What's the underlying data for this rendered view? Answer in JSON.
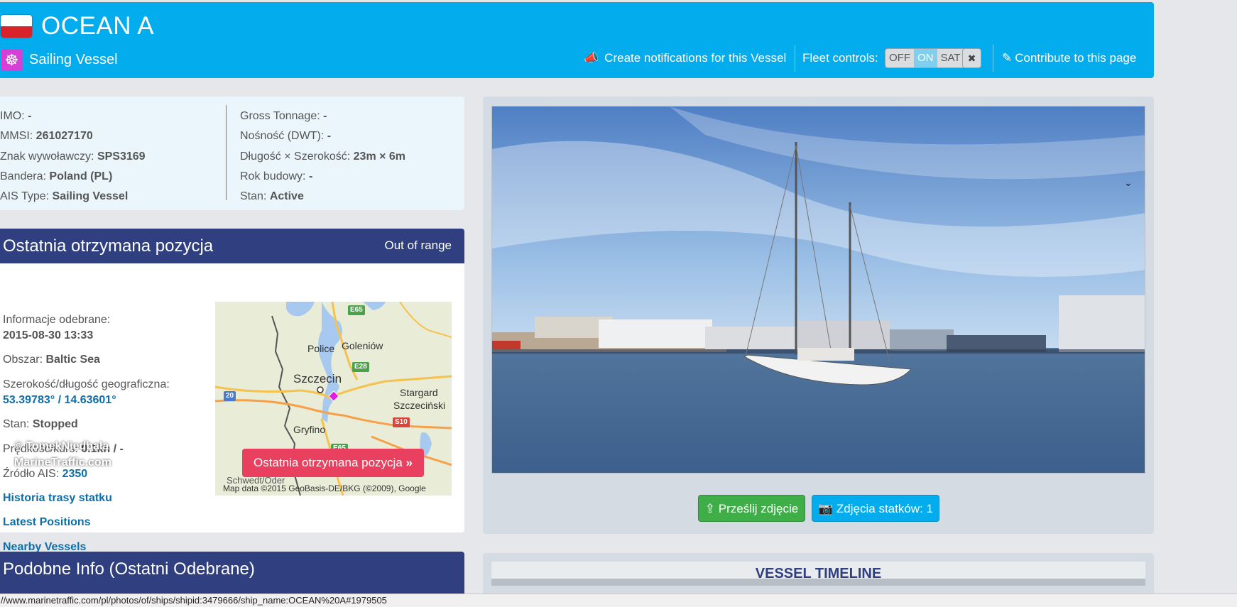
{
  "header": {
    "vessel_name": "OCEAN A",
    "vessel_type": "Sailing Vessel",
    "notifications_label": "Create notifications for this Vessel",
    "fleet_controls_label": "Fleet controls:",
    "fleet_options": [
      "OFF",
      "ON",
      "SAT"
    ],
    "fleet_selected": "ON",
    "contribute_label": "Contribute to this page",
    "header_color": "#02aced"
  },
  "info": {
    "left": [
      {
        "label": "IMO:",
        "value": "-"
      },
      {
        "label": "MMSI:",
        "value": "261027170"
      },
      {
        "label": "Znak wywoławczy:",
        "value": "SPS3169"
      },
      {
        "label": "Bandera:",
        "value": "Poland (PL)"
      },
      {
        "label": "AIS Type:",
        "value": "Sailing Vessel"
      }
    ],
    "right": [
      {
        "label": "Gross Tonnage:",
        "value": "-"
      },
      {
        "label": "Nośność (DWT):",
        "value": "-"
      },
      {
        "label": "Długość × Szerokość:",
        "value": "23m × 6m"
      },
      {
        "label": "Rok budowy:",
        "value": "-"
      },
      {
        "label": "Stan:",
        "value": "Active"
      }
    ]
  },
  "position": {
    "title": "Ostatnia otrzymana pozycja",
    "status": "Out of range",
    "received_label": "Informacje odebrane:",
    "received_value": "2015-08-30 13:33",
    "area_label": "Obszar:",
    "area_value": "Baltic Sea",
    "latlon_label": "Szerokość/długość geograficzna:",
    "latlon_value": "53.39783° / 14.63601°",
    "state_label": "Stan:",
    "state_value": "Stopped",
    "speed_label": "Prędkość/kurs:",
    "speed_value": "0.1kn / -",
    "source_label": "Źródło AIS:",
    "source_value": "2350",
    "links": [
      "Historia trasy statku",
      "Latest Positions",
      "Nearby Vessels"
    ],
    "map_button": "Ostatnia otrzymana pozycja",
    "map_copyright": "Map data ©2015 GeoBasis-DE/BKG (©2009), Google",
    "map_labels": {
      "police": "Police",
      "goleniow": "Goleniów",
      "szczecin": "Szczecin",
      "stargard1": "Stargard",
      "stargard2": "Szczeciński",
      "gryfino": "Gryfino",
      "schwedt": "Schwedt/Oder"
    },
    "roads": {
      "e65": "E65",
      "e28": "E28",
      "r20": "20",
      "s10": "S10",
      "e65b": "E65"
    }
  },
  "photo": {
    "credit_author": "© TomekNiedbala",
    "credit_site": "MarineTraffic.com",
    "upload_label": "Prześlij zdjęcie",
    "photos_label": "Zdjęcia statków: 1"
  },
  "similar": {
    "title": "Podobne Info (Ostatni Odebrane)"
  },
  "timeline": {
    "title": "VESSEL TIMELINE"
  },
  "statusbar": {
    "url": "//www.marinetraffic.com/pl/photos/of/ships/shipid:3479666/ship_name:OCEAN%20A#1979505"
  }
}
